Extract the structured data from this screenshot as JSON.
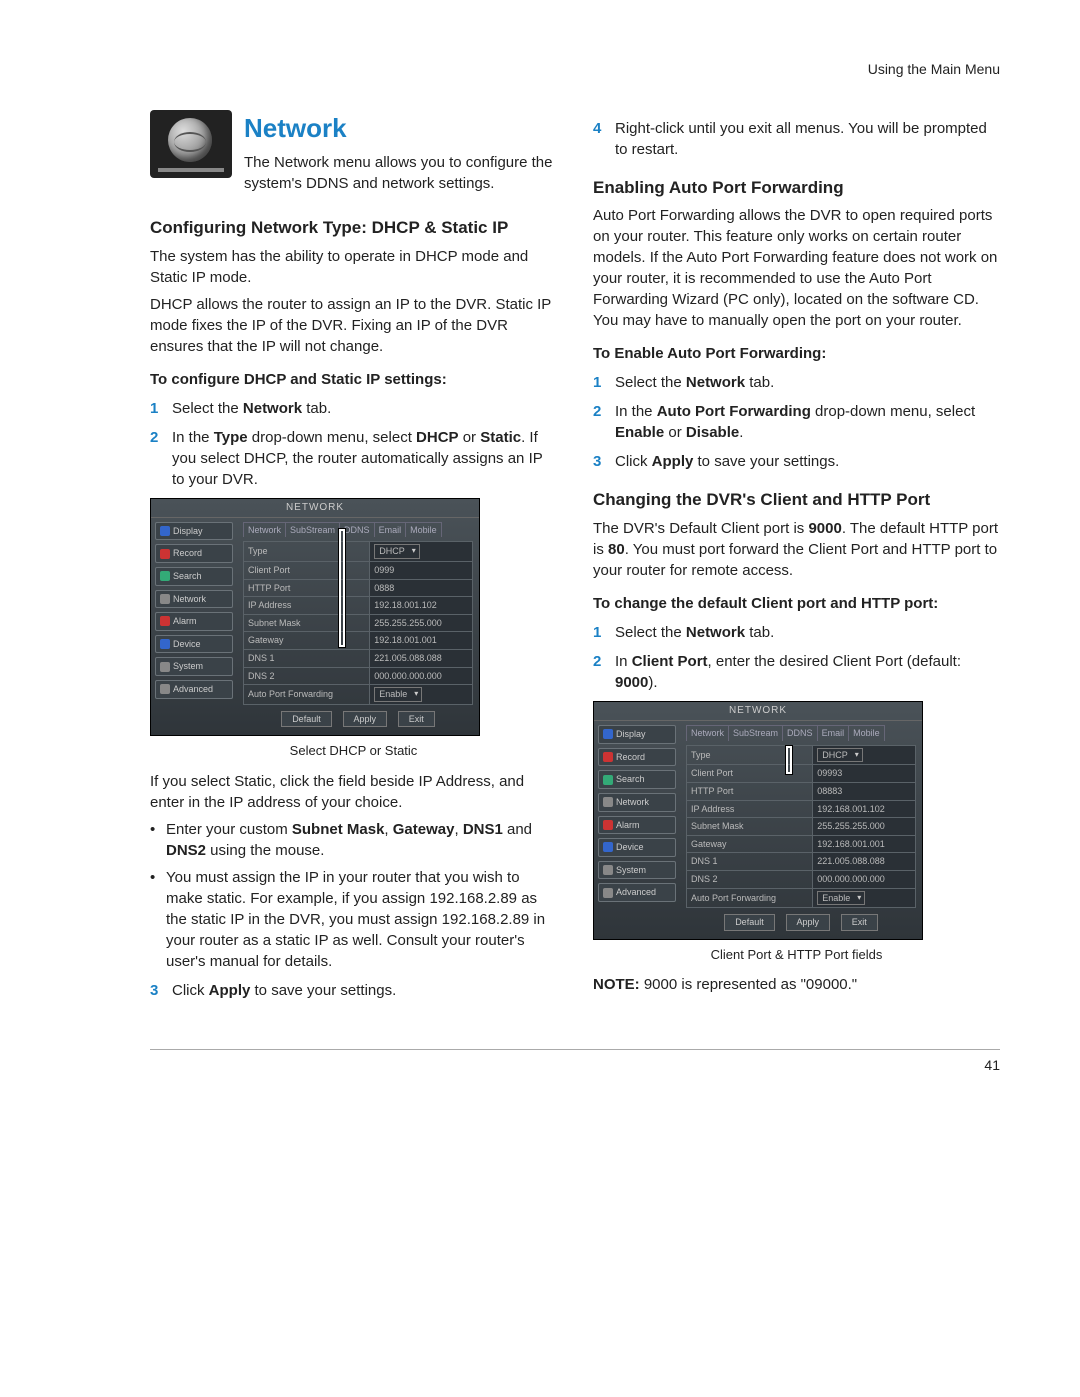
{
  "header": {
    "section": "Using the Main Menu"
  },
  "title": "Network",
  "intro": "The Network menu allows you to configure the system's DDNS and network settings.",
  "left": {
    "h_config": "Configuring Network Type: DHCP & Static IP",
    "p1": "The system has the ability to operate in DHCP mode and Static IP mode.",
    "p2": "DHCP allows the router to assign an IP to the DVR. Static IP mode fixes the IP of the DVR. Fixing an IP of the DVR ensures that the IP will not change.",
    "h_configsteps": "To configure DHCP and Static IP settings:",
    "steps_a": {
      "n1": "1",
      "t1a": "Select the ",
      "t1b": "Network",
      "t1c": " tab.",
      "n2": "2",
      "t2a": "In the ",
      "t2b": "Type",
      "t2c": " drop-down menu, select ",
      "t2d": "DHCP",
      "t2e": " or ",
      "t2f": "Static",
      "t2g": ". If you select DHCP, the router automatically assigns an IP to your DVR."
    },
    "ss1_caption": "Select DHCP or Static",
    "p3": "If you select Static, click the field beside IP Address, and enter in the IP address of your choice.",
    "b1a": "Enter your custom ",
    "b1b": "Subnet Mask",
    "b1c": ", ",
    "b1d": "Gateway",
    "b1e": ", ",
    "b1f": "DNS1",
    "b1g": " and ",
    "b1h": "DNS2",
    "b1i": " using the mouse.",
    "b2": "You must assign the IP in your router that you wish to make static. For example, if you assign 192.168.2.89 as the static IP in the DVR, you must assign 192.168.2.89 in your router as a static IP as well. Consult your router's user's manual for details.",
    "n3": "3",
    "t3a": "Click ",
    "t3b": "Apply",
    "t3c": " to save your settings."
  },
  "right": {
    "n4": "4",
    "t4": "Right-click until you exit all menus. You will be prompted to restart.",
    "h_auto": "Enabling Auto Port Forwarding",
    "p_auto": "Auto Port Forwarding allows the DVR to open required ports on your router. This feature only works on certain router models. If the Auto Port Forwarding feature does not work on your router, it is recommended to use the Auto Port Forwarding Wizard (PC only), located on the software CD. You may have to manually open the port on your router.",
    "h_autosteps": "To Enable Auto Port Forwarding:",
    "a1n": "1",
    "a1a": "Select the ",
    "a1b": "Network",
    "a1c": " tab.",
    "a2n": "2",
    "a2a": "In the ",
    "a2b": "Auto Port Forwarding",
    "a2c": " drop-down menu, select ",
    "a2d": "Enable",
    "a2e": " or ",
    "a2f": "Disable",
    "a2g": ".",
    "a3n": "3",
    "a3a": "Click ",
    "a3b": "Apply",
    "a3c": " to save your settings.",
    "h_ports": "Changing the DVR's Client and HTTP Port",
    "p_ports_a": "The DVR's Default Client port is ",
    "p_ports_b": "9000",
    "p_ports_c": ". The default HTTP port is ",
    "p_ports_d": "80",
    "p_ports_e": ". You must port forward the Client Port and HTTP port to your router for remote access.",
    "h_portsteps": "To change the default Client port and HTTP port:",
    "c1n": "1",
    "c1a": "Select the ",
    "c1b": "Network",
    "c1c": " tab.",
    "c2n": "2",
    "c2a": "In ",
    "c2b": "Client Port",
    "c2c": ", enter the desired Client Port (default: ",
    "c2d": "9000",
    "c2e": ").",
    "ss2_caption": "Client Port & HTTP Port fields",
    "note_a": "NOTE:",
    "note_b": " 9000 is represented as \"09000.\""
  },
  "ss": {
    "title": "NETWORK",
    "side": [
      "Display",
      "Record",
      "Search",
      "Network",
      "Alarm",
      "Device",
      "System",
      "Advanced"
    ],
    "tabs": [
      "Network",
      "SubStream",
      "DDNS",
      "Email",
      "Mobile"
    ],
    "rows1": [
      [
        "Type",
        "DHCP"
      ],
      [
        "Client Port",
        "0999"
      ],
      [
        "HTTP Port",
        "0888"
      ],
      [
        "IP Address",
        "192.18.001.102"
      ],
      [
        "Subnet Mask",
        "255.255.255.000"
      ],
      [
        "Gateway",
        "192.18.001.001"
      ],
      [
        "DNS 1",
        "221.005.088.088"
      ],
      [
        "DNS 2",
        "000.000.000.000"
      ],
      [
        "Auto Port Forwarding",
        "Enable"
      ]
    ],
    "rows2": [
      [
        "Type",
        "DHCP"
      ],
      [
        "Client Port",
        "09993"
      ],
      [
        "HTTP Port",
        "08883"
      ],
      [
        "IP Address",
        "192.168.001.102"
      ],
      [
        "Subnet Mask",
        "255.255.255.000"
      ],
      [
        "Gateway",
        "192.168.001.001"
      ],
      [
        "DNS 1",
        "221.005.088.088"
      ],
      [
        "DNS 2",
        "000.000.000.000"
      ],
      [
        "Auto Port Forwarding",
        "Enable"
      ]
    ],
    "btns": [
      "Default",
      "Apply",
      "Exit"
    ]
  },
  "page": "41"
}
